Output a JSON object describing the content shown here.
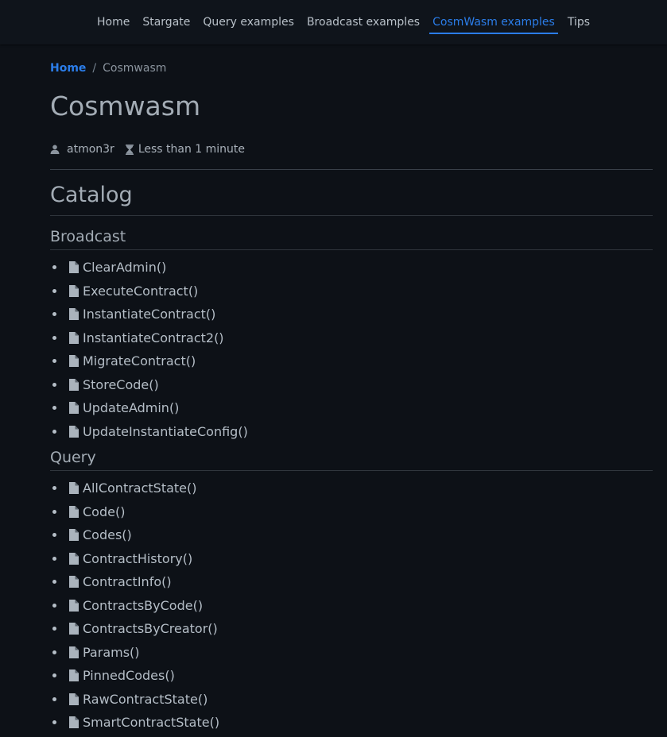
{
  "nav": {
    "links": [
      {
        "label": "Home",
        "active": false
      },
      {
        "label": "Stargate",
        "active": false
      },
      {
        "label": "Query examples",
        "active": false
      },
      {
        "label": "Broadcast examples",
        "active": false
      },
      {
        "label": "CosmWasm examples",
        "active": true
      },
      {
        "label": "Tips",
        "active": false
      }
    ]
  },
  "breadcrumb": {
    "home": "Home",
    "separator": "/",
    "current": "Cosmwasm"
  },
  "page": {
    "title": "Cosmwasm",
    "author": "atmon3r",
    "reading_time": "Less than 1 minute",
    "catalog_heading": "Catalog"
  },
  "sections": {
    "broadcast": {
      "title": "Broadcast",
      "items": [
        "ClearAdmin()",
        "ExecuteContract()",
        "InstantiateContract()",
        "InstantiateContract2()",
        "MigrateContract()",
        "StoreCode()",
        "UpdateAdmin()",
        "UpdateInstantiateConfig()"
      ]
    },
    "query": {
      "title": "Query",
      "items": [
        "AllContractState()",
        "Code()",
        "Codes()",
        "ContractHistory()",
        "ContractInfo()",
        "ContractsByCode()",
        "ContractsByCreator()",
        "Params()",
        "PinnedCodes()",
        "RawContractState()",
        "SmartContractState()"
      ]
    }
  },
  "icons": {
    "author": "user-icon",
    "reading_time": "hourglass-icon",
    "item": "file-icon"
  },
  "colors": {
    "background": "#0d1117",
    "accent": "#2b7de9",
    "text": "#adbac7"
  }
}
